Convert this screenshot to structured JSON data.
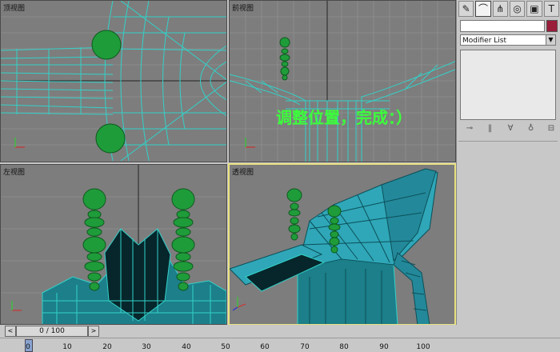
{
  "viewports": {
    "top": {
      "label": "顶视图"
    },
    "front": {
      "label": "前视图"
    },
    "left": {
      "label": "左视图"
    },
    "persp": {
      "label": "透视图"
    }
  },
  "overlay_caption": "调整位置，完成：）",
  "command_panel": {
    "tabs": [
      {
        "name": "create-icon",
        "glyph": "✎"
      },
      {
        "name": "modify-icon",
        "glyph": "⌒"
      },
      {
        "name": "hierarchy-icon",
        "glyph": "⋔"
      },
      {
        "name": "motion-icon",
        "glyph": "◎"
      },
      {
        "name": "display-icon",
        "glyph": "▣"
      },
      {
        "name": "utilities-icon",
        "glyph": "T"
      }
    ],
    "name_value": "",
    "color_swatch": "#9a1d3a",
    "modifier_list": "Modifier List",
    "stack_buttons": [
      "⊸",
      "‖",
      "∀",
      "♁",
      "⊟"
    ]
  },
  "timeline": {
    "frame_counter": "0 / 100",
    "ticks": [
      "0",
      "10",
      "20",
      "30",
      "40",
      "50",
      "60",
      "70",
      "80",
      "90",
      "100"
    ]
  },
  "colors": {
    "wire": "#33d1c8",
    "green": "#1f9c3a",
    "viewport_bg": "#7d7d7d",
    "active_border": "#e8e080",
    "caption": "#3bff3b"
  }
}
